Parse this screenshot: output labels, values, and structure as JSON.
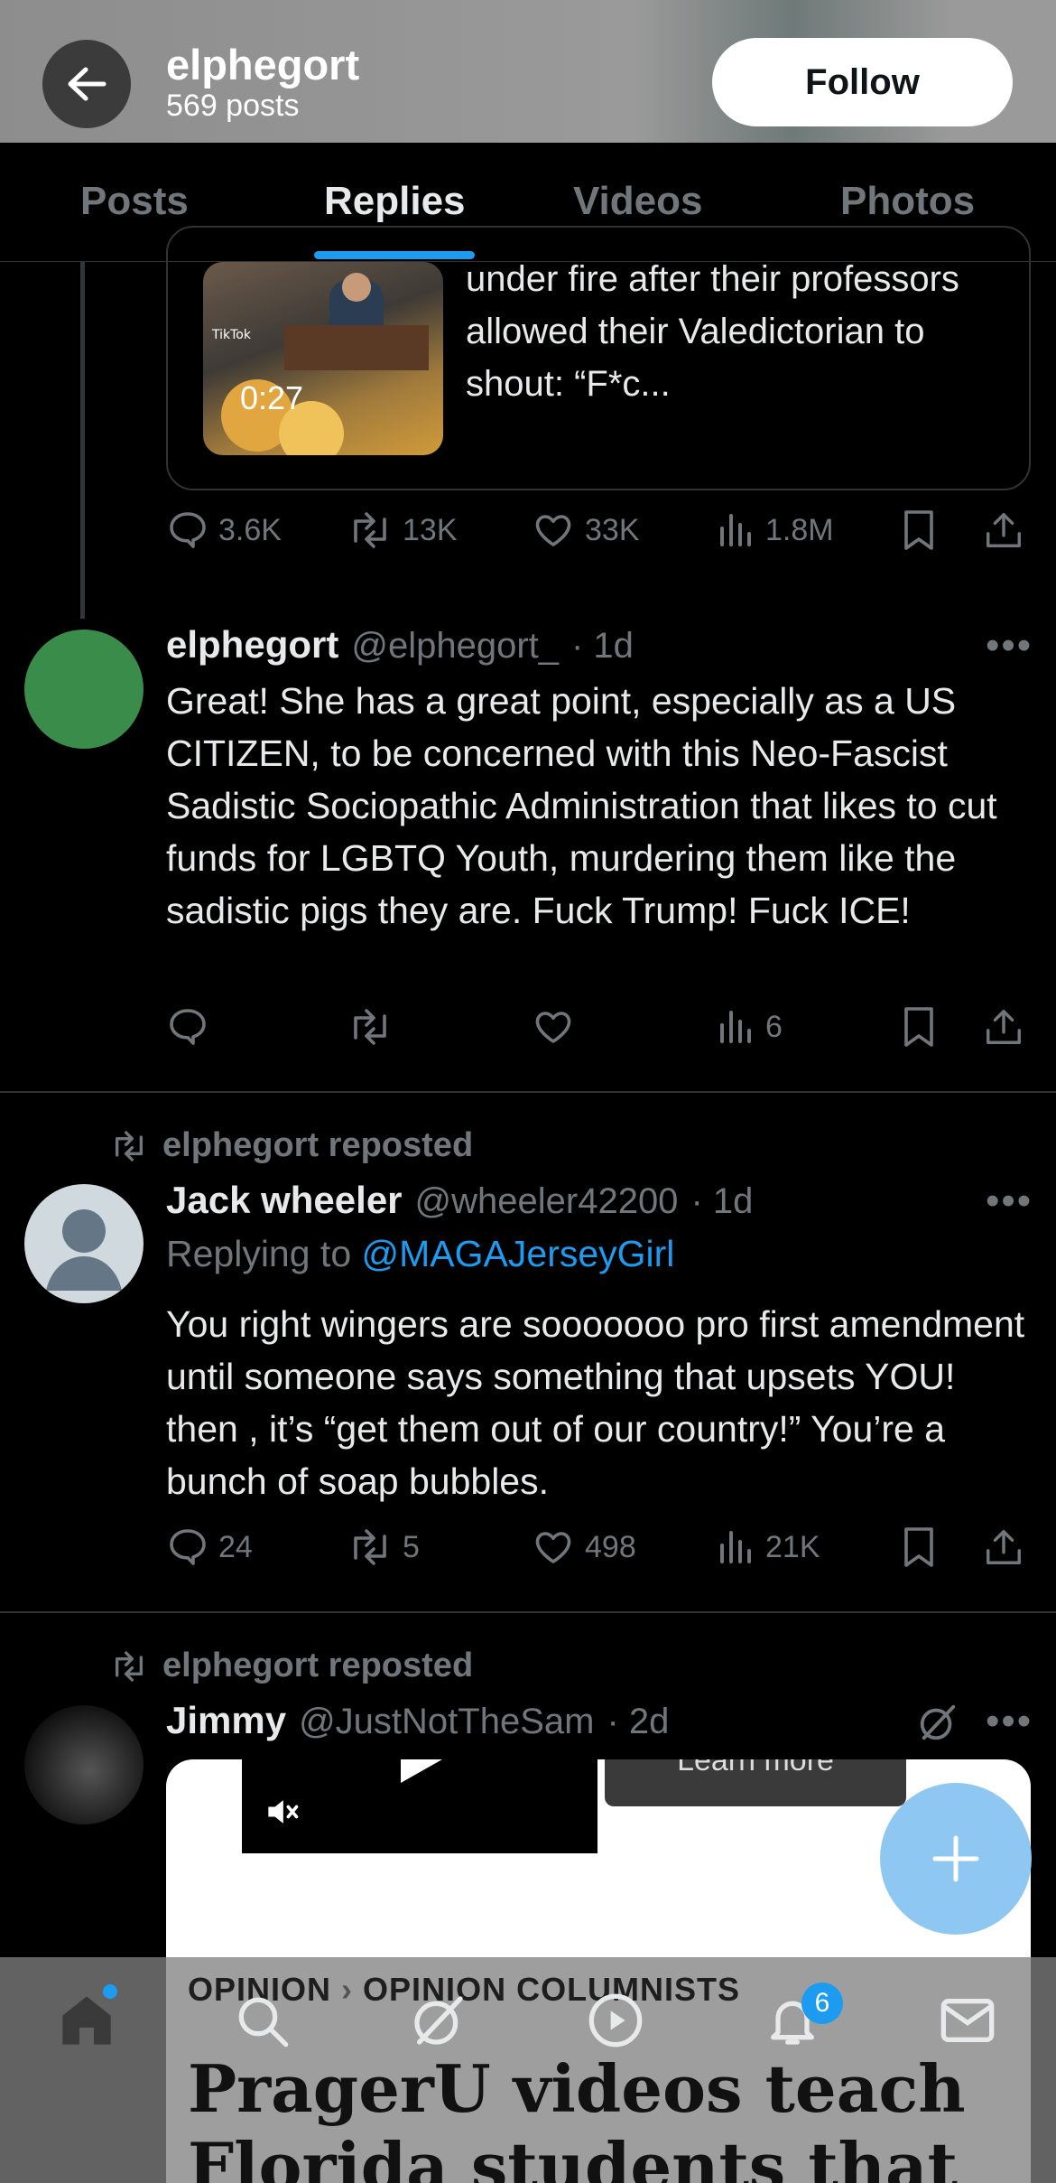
{
  "header": {
    "name": "elphegort",
    "post_count": "569 posts",
    "follow_label": "Follow"
  },
  "tabs": [
    {
      "label": "Posts"
    },
    {
      "label": "Replies",
      "active": true
    },
    {
      "label": "Videos"
    },
    {
      "label": "Photos"
    }
  ],
  "quoted_post": {
    "text": "under fire after their professors allowed their Valedictorian to shout: “F*c...",
    "duration": "0:27",
    "actions": {
      "replies": "3.6K",
      "reposts": "13K",
      "likes": "33K",
      "views": "1.8M"
    }
  },
  "reply_post": {
    "name": "elphegort",
    "handle": "@elphegort_",
    "time": "· 1d",
    "avatar_color": "#3a8c4a",
    "text": "Great! She has a great point, especially as a US CITIZEN, to be concerned with this Neo-Fascist Sadistic Sociopathic Administration that likes to cut funds for LGBTQ Youth, murdering them like the sadistic pigs they are. Fuck Trump! Fuck ICE!",
    "actions": {
      "views": "6"
    }
  },
  "repost1": {
    "repost_label": "elphegort reposted",
    "name": "Jack wheeler",
    "handle": "@wheeler42200",
    "time": "· 1d",
    "replying_prefix": "Replying to",
    "replying_to": "@MAGAJerseyGirl",
    "text": "You right wingers are sooooooo pro first amendment until someone says something that upsets YOU! then , it’s “get them out of our country!” You’re a bunch of soap bubbles.",
    "actions": {
      "replies": "24",
      "reposts": "5",
      "likes": "498",
      "views": "21K"
    }
  },
  "repost2": {
    "repost_label": "elphegort reposted",
    "name": "Jimmy",
    "handle": "@JustNotTheSam",
    "time": "· 2d",
    "embed_learn_more": "Learn more",
    "article_crumb_1": "OPINION",
    "article_crumb_2": "OPINION COLUMNISTS",
    "article_headline": "PragerU videos teach Florida students that"
  },
  "bottom_nav": {
    "notifications_badge": "6",
    "items": [
      "home-icon",
      "search-icon",
      "grok-icon",
      "video-icon",
      "notifications-icon",
      "messages-icon"
    ]
  },
  "colors": {
    "accent": "#1d9bf0",
    "fab": "#8ec7f2",
    "muted": "#71767b"
  }
}
